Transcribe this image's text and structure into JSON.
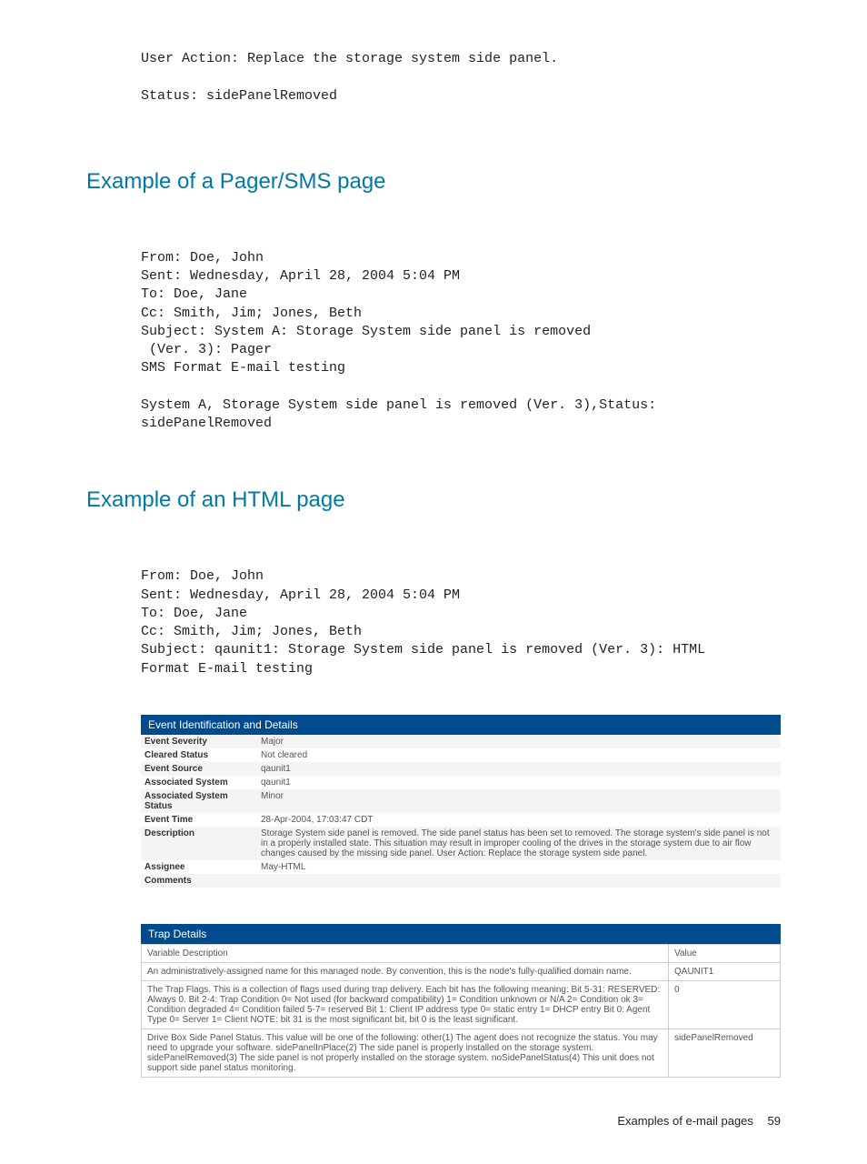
{
  "intro_block": "User Action: Replace the storage system side panel.\n\nStatus: sidePanelRemoved",
  "section_pager_title": "Example of a Pager/SMS page",
  "pager_block": "From: Doe, John\nSent: Wednesday, April 28, 2004 5:04 PM\nTo: Doe, Jane\nCc: Smith, Jim; Jones, Beth\nSubject: System A: Storage System side panel is removed\n (Ver. 3): Pager\nSMS Format E-mail testing\n\nSystem A, Storage System side panel is removed (Ver. 3),Status:\nsidePanelRemoved",
  "section_html_title": "Example of an HTML page",
  "html_block": "From: Doe, John\nSent: Wednesday, April 28, 2004 5:04 PM\nTo: Doe, Jane\nCc: Smith, Jim; Jones, Beth\nSubject: qaunit1: Storage System side panel is removed (Ver. 3): HTML\nFormat E-mail testing",
  "event_table": {
    "title": "Event Identification and Details",
    "rows": [
      {
        "k": "Event Severity",
        "v": "Major"
      },
      {
        "k": "Cleared Status",
        "v": "Not cleared"
      },
      {
        "k": "Event Source",
        "v": "qaunit1"
      },
      {
        "k": "Associated System",
        "v": "qaunit1"
      },
      {
        "k": "Associated System Status",
        "v": "Minor"
      },
      {
        "k": "Event Time",
        "v": "28-Apr-2004, 17:03:47 CDT"
      },
      {
        "k": "Description",
        "v": "Storage System side panel is removed. The side panel status has been set to removed. The storage system's side panel is not in a properly installed state. This situation may result in improper cooling of the drives in the storage system due to air flow changes caused by the missing side panel. User Action: Replace the storage system side panel."
      },
      {
        "k": "Assignee",
        "v": "May-HTML"
      },
      {
        "k": "Comments",
        "v": ""
      }
    ]
  },
  "trap_table": {
    "title": "Trap Details",
    "col_desc": "Variable Description",
    "col_val": "Value",
    "rows": [
      {
        "desc": "An administratively-assigned name for this managed node. By convention, this is the node's fully-qualified domain name.",
        "val": "QAUNIT1"
      },
      {
        "desc": "The Trap Flags. This is a collection of flags used during trap delivery. Each bit has the following meaning: Bit 5-31: RESERVED: Always 0. Bit 2-4: Trap Condition 0= Not used (for backward compatibility) 1= Condition unknown or N/A 2= Condition ok 3= Condition degraded 4= Condition failed 5-7= reserved Bit 1: Client IP address type 0= static entry 1= DHCP entry Bit 0: Agent Type 0= Server 1= Client NOTE: bit 31 is the most significant bit, bit 0 is the least significant.",
        "val": "0"
      },
      {
        "desc": "Drive Box Side Panel Status. This value will be one of the following: other(1) The agent does not recognize the status. You may need to upgrade your software. sidePanelInPlace(2) The side panel is properly installed on the storage system. sidePanelRemoved(3) The side panel is not properly installed on the storage system. noSidePanelStatus(4) This unit does not support side panel status monitoring.",
        "val": "sidePanelRemoved"
      }
    ]
  },
  "footer_text": "Examples of e-mail pages",
  "page_number": "59"
}
